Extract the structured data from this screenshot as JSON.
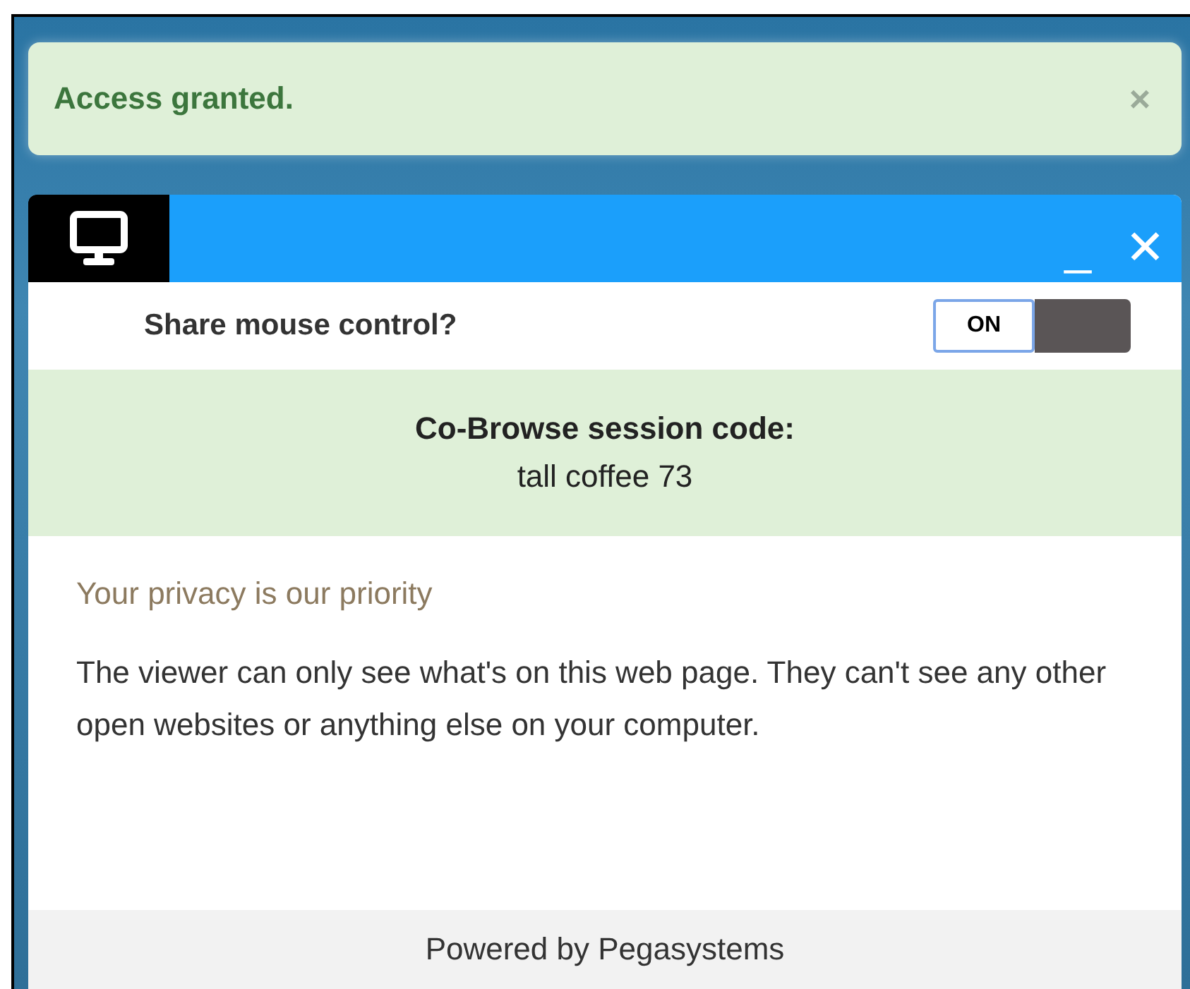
{
  "alert": {
    "message": "Access granted.",
    "close": "×"
  },
  "widget": {
    "window_controls": {
      "minimize": "_",
      "close": "✕"
    },
    "share_control": {
      "label": "Share mouse control?",
      "toggle": {
        "on": true,
        "label": "ON"
      }
    },
    "session": {
      "title": "Co-Browse session code:",
      "code": "tall coffee 73"
    },
    "privacy": {
      "heading": "Your privacy is our priority",
      "body": "The viewer can only see what's on this web page. They can't see any other open websites or anything else on your computer."
    },
    "footer": "Powered by Pegasystems"
  }
}
